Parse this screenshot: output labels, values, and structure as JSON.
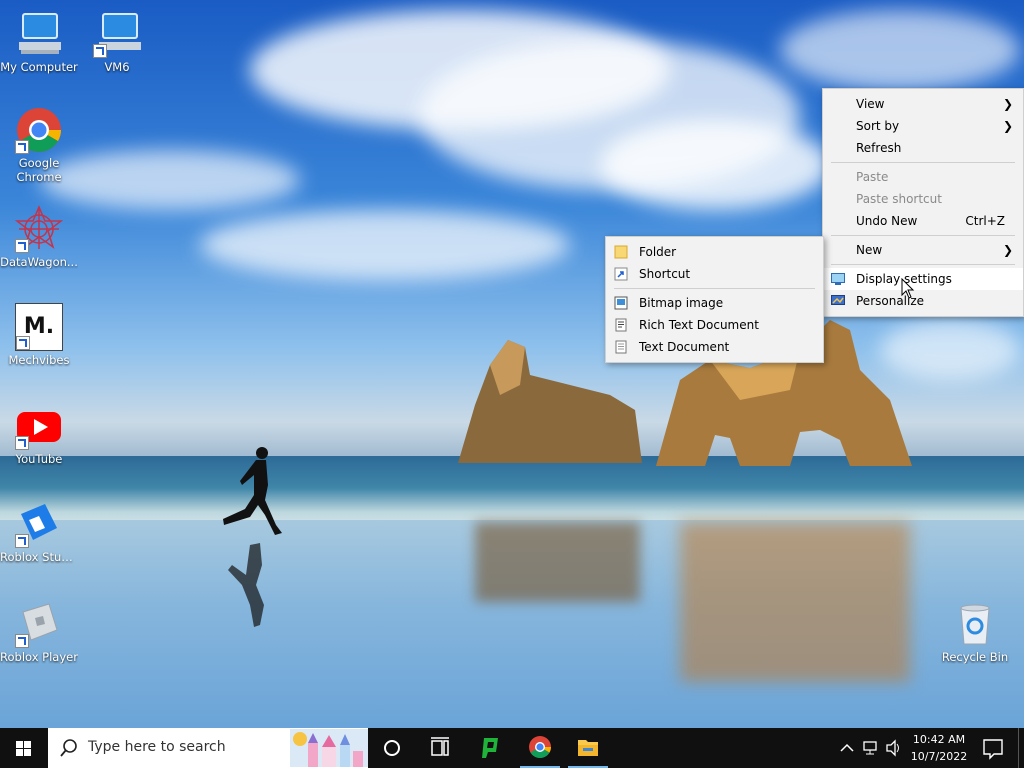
{
  "desktop_icons": [
    {
      "label": "My Computer",
      "icon": "computer-icon"
    },
    {
      "label": "VM6",
      "icon": "computer-shortcut-icon"
    },
    {
      "label": "Google Chrome",
      "icon": "chrome-icon"
    },
    {
      "label": "DataWagon...",
      "icon": "datawagon-icon"
    },
    {
      "label": "Mechvibes",
      "icon": "mechvibes-icon",
      "glyph": "M."
    },
    {
      "label": "YouTube",
      "icon": "youtube-icon"
    },
    {
      "label": "Roblox Studio",
      "icon": "roblox-studio-icon"
    },
    {
      "label": "Roblox Player",
      "icon": "roblox-player-icon"
    },
    {
      "label": "Recycle Bin",
      "icon": "recycle-bin-icon"
    }
  ],
  "context_menu": {
    "items": [
      {
        "label": "View",
        "submenu": true
      },
      {
        "label": "Sort by",
        "submenu": true
      },
      {
        "label": "Refresh"
      },
      {
        "label": "Paste",
        "disabled": true
      },
      {
        "label": "Paste shortcut",
        "disabled": true
      },
      {
        "label": "Undo New",
        "shortcut": "Ctrl+Z"
      },
      {
        "label": "New",
        "submenu": true
      },
      {
        "label": "Display settings",
        "icon": "display-icon"
      },
      {
        "label": "Personalize",
        "icon": "personalize-icon"
      }
    ]
  },
  "new_submenu": {
    "items": [
      {
        "label": "Folder",
        "icon": "folder-icon"
      },
      {
        "label": "Shortcut",
        "icon": "shortcut-icon"
      },
      {
        "label": "Bitmap image",
        "icon": "bitmap-icon"
      },
      {
        "label": "Rich Text Document",
        "icon": "rtf-icon"
      },
      {
        "label": "Text Document",
        "icon": "text-document-icon"
      }
    ]
  },
  "taskbar": {
    "search_placeholder": "Type here to search",
    "pinned": [
      "cortana-icon",
      "task-view-icon",
      "green-app-icon",
      "chrome-icon",
      "file-explorer-icon"
    ],
    "time": "10:42 AM",
    "date": "10/7/2022"
  },
  "colors": {
    "taskbar": "#101010",
    "menu_bg": "#f2f2f2",
    "accent_blue": "#1f5fcf"
  }
}
